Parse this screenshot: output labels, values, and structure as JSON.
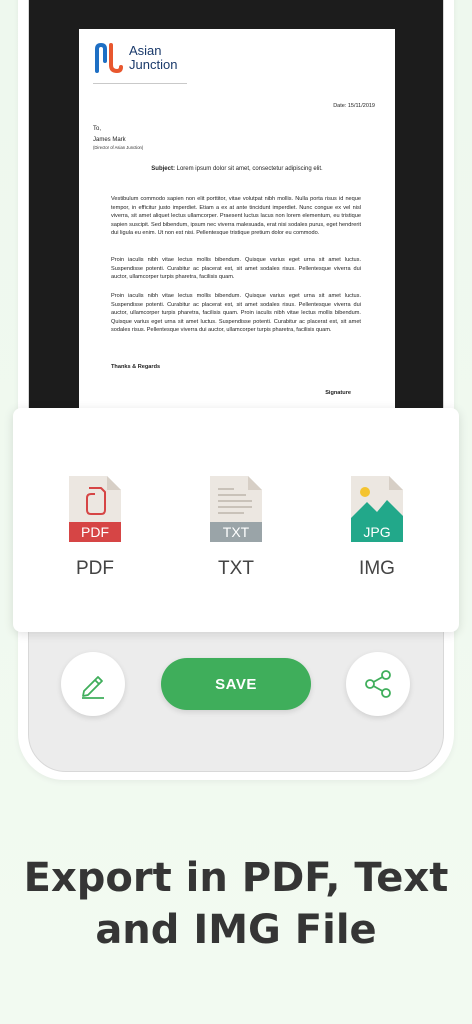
{
  "document": {
    "logo_line1": "Asian",
    "logo_line2": "Junction",
    "date": "Date:     15/11/2019",
    "to": "To,",
    "name": "James Mark",
    "role": "(Director of Asian Junction)",
    "subject_label": "Subject:",
    "subject_text": "Lorem ipsum dolor sit amet, consectetur adipiscing elit.",
    "paragraphs": [
      "        Vestibulum commodo sapien non elit porttitor, vitae volutpat nibh mollis. Nulla porta risus id neque tempor, in efficitur justo imperdiet. Etiam a ex at ante tincidunt imperdiet. Nunc congue ex vel nisl viverra, sit amet aliquet lectus ullamcorper. Praesent luctus lacus non lorem elementum, eu tristique sapien suscipit. Sed bibendum, ipsum nec viverra malesuada, erat nisi sodales purus, eget hendrerit dui ligula eu enim. Ut non est nisi. Pellentesque tristique pretium dolor eu commodo.",
      "Proin iaculis nibh vitae lectus mollis bibendum. Quisque varius eget urna sit amet luctus. Suspendisse potenti. Curabitur ac placerat est, sit amet sodales risus. Pellentesque viverra dui auctor, ullamcorper turpis pharetra, facilisis quam.",
      "Proin iaculis nibh vitae lectus mollis bibendum. Quisque varius eget urna sit amet luctus. Suspendisse potenti. Curabitur ac placerat est, sit amet sodales risus. Pellentesque viverra dui auctor, ullamcorper turpis pharetra, facilisis quam. Proin iaculis nibh vitae lectus mollis bibendum. Quisque varius eget urna sit amet luctus. Suspendisse potenti. Curabitur ac placerat est, sit amet sodales risus. Pellentesque viverra dui auctor, ullamcorper turpis pharetra, facilisis quam."
    ],
    "regards": "Thanks & Regards",
    "signature": "Signature"
  },
  "export": {
    "options": [
      {
        "label": "PDF",
        "badge": "PDF",
        "icon": "pdf-file-icon",
        "color": "#d64545"
      },
      {
        "label": "TXT",
        "badge": "TXT",
        "icon": "txt-file-icon",
        "color": "#9aa4a8"
      },
      {
        "label": "IMG",
        "badge": "JPG",
        "icon": "jpg-file-icon",
        "color": "#22a88a"
      }
    ]
  },
  "controls": {
    "save_label": "SAVE",
    "edit_icon": "pencil-icon",
    "share_icon": "share-icon",
    "accent_color": "#3fae5b"
  },
  "headline": {
    "line1": "Export in PDF, Text",
    "line2": "and IMG File"
  }
}
